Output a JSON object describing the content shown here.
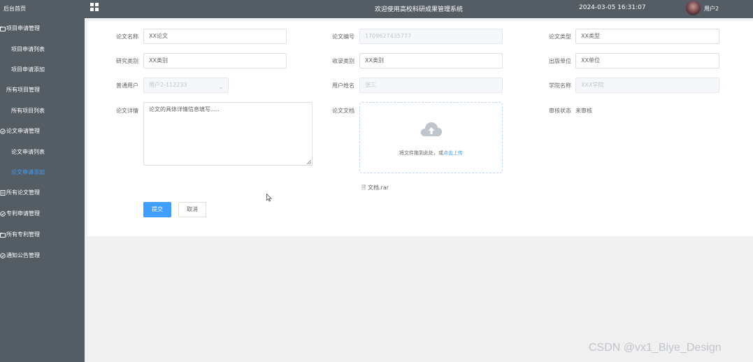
{
  "sidebar": {
    "home": "后台首页",
    "groups": [
      {
        "label": "项目申请管理",
        "items": [
          "项目申请列表",
          "项目申请添加"
        ]
      },
      {
        "label": "所有项目管理",
        "items": [
          "所有项目列表"
        ]
      },
      {
        "label": "论文申请管理",
        "items": [
          "论文申请列表",
          "论文申请添加"
        ]
      },
      {
        "label": "所有论文管理",
        "items": []
      },
      {
        "label": "专利申请管理",
        "items": []
      },
      {
        "label": "所有专利管理",
        "items": []
      },
      {
        "label": "通知公告管理",
        "items": []
      }
    ],
    "active_item": "论文申请添加"
  },
  "header": {
    "title": "欢迎使用高校科研成果管理系统",
    "datetime": "2024-03-05 16:31:07",
    "username": "用户2"
  },
  "form": {
    "paper_name": {
      "label": "论文名称",
      "value": "XX论文"
    },
    "paper_no": {
      "label": "论文编号",
      "value": "1709627435777"
    },
    "paper_type": {
      "label": "论文类型",
      "value": "XX类型"
    },
    "research_category": {
      "label": "研究类别",
      "value": "XX类别"
    },
    "included_category": {
      "label": "收录类别",
      "value": "XX类别"
    },
    "publisher": {
      "label": "出版单位",
      "value": "XX单位"
    },
    "normal_user": {
      "label": "普通用户",
      "value": "用户2-112233"
    },
    "user_name": {
      "label": "用户姓名",
      "value": "张三"
    },
    "college_name": {
      "label": "学院名称",
      "value": "XXX学院"
    },
    "paper_detail": {
      "label": "论文详情",
      "value": "论文的具体详情信息填写....."
    },
    "paper_doc": {
      "label": "论文文档",
      "upload_text": "将文件拖到此处，或",
      "upload_link": "点击上传",
      "file_name": "文档.rar"
    },
    "review_status": {
      "label": "审核状态",
      "value": "未审核"
    },
    "submit_label": "提交",
    "cancel_label": "取消"
  },
  "watermark": "CSDN @vx1_Biye_Design",
  "colors": {
    "sidebar": "#545c64",
    "accent": "#409eff",
    "page_bg": "#f0f0f0"
  }
}
